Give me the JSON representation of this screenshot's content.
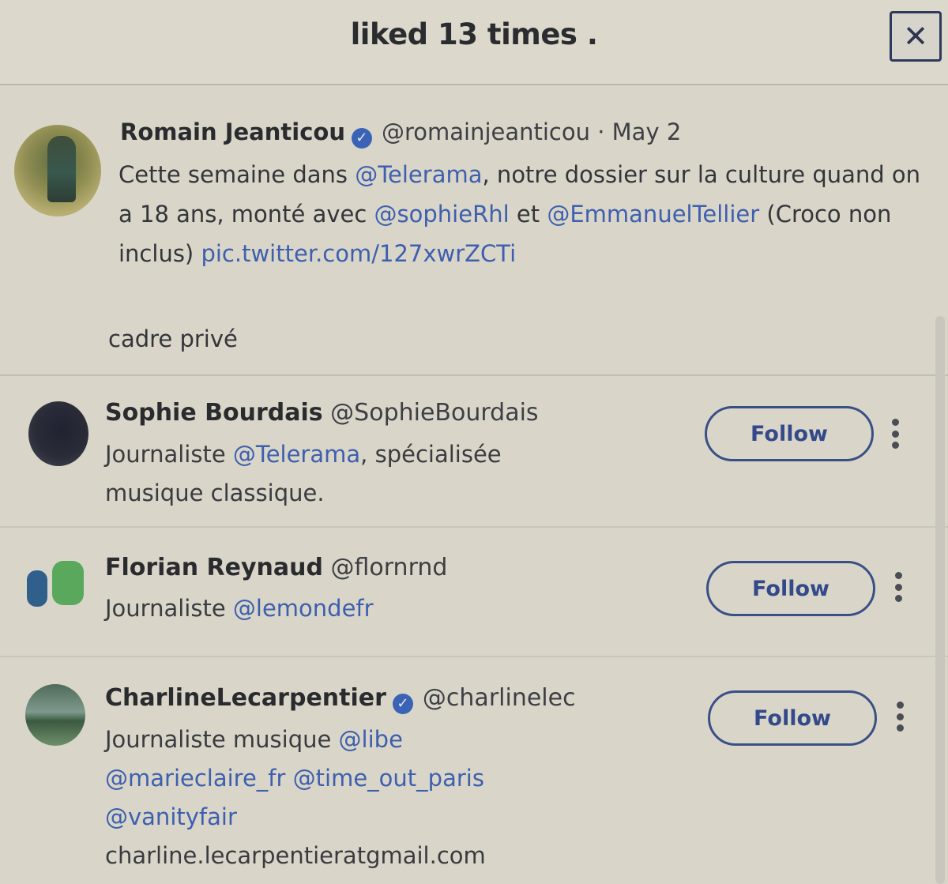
{
  "header": {
    "title": "liked 13 times .",
    "close_label": "✕"
  },
  "tweet": {
    "author_name": "Romain Jeanticou",
    "author_handle": "@romainjeanticou",
    "date": "· May 2",
    "text_1": "Cette semaine dans ",
    "mention_1": "@Telerama",
    "text_2": ", notre dossier sur la culture quand on a 18 ans, monté avec ",
    "mention_2": "@sophieRhl",
    "text_3": " et ",
    "mention_3": "@EmmanuelTellier",
    "text_4": " (Croco non inclus) ",
    "link": "pic.twitter.com/127xwrZCTi",
    "context_label": "cadre privé"
  },
  "users": [
    {
      "name": "Sophie Bourdais",
      "handle": "@SophieBourdais",
      "bio_1": "Journaliste ",
      "bio_mention": "@Telerama",
      "bio_2": ", spécialisée musique classique.",
      "follow_label": "Follow"
    },
    {
      "name": "Florian Reynaud",
      "handle": "@flornrnd",
      "bio_1": "Journaliste ",
      "bio_mention": "@lemondefr",
      "follow_label": "Follow"
    },
    {
      "name": "CharlineLecarpentier",
      "handle": "@charlinelec",
      "bio_1": "Journaliste musique ",
      "bio_mention_1": "@libe",
      "bio_mention_2": "@marieclaire_fr",
      "bio_mention_3": "@time_out_paris",
      "bio_mention_4": "@vanityfair",
      "bio_email": "charline.lecarpentieratgmail.com",
      "follow_label": "Follow"
    }
  ],
  "colors": {
    "background": "#d9d6c9",
    "link": "#3d5fae",
    "verified": "#3b63b5",
    "button_border": "#3a4f86"
  }
}
